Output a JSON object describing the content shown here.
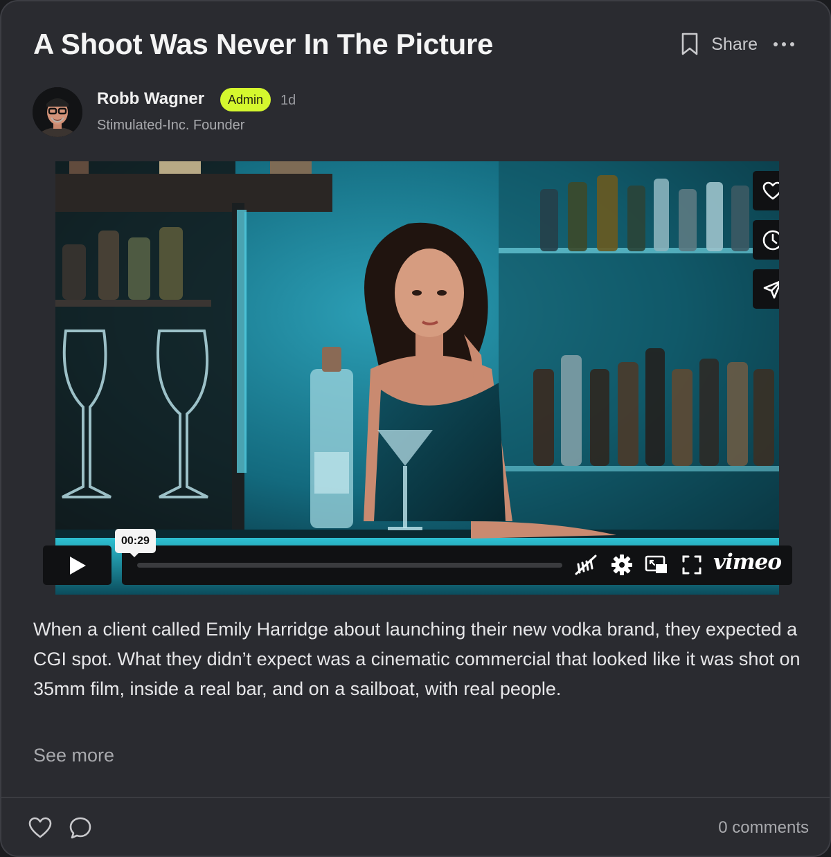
{
  "post": {
    "title": "A Shoot Was Never In The Picture",
    "share_label": "Share"
  },
  "author": {
    "name": "Robb Wagner",
    "badge": "Admin",
    "time": "1d",
    "role": "Stimulated-Inc. Founder"
  },
  "video": {
    "timestamp": "00:29",
    "brand": "vimeo",
    "icons": [
      "heart-icon",
      "clock-icon",
      "send-icon",
      "play-icon",
      "hd-off-icon",
      "settings-icon",
      "pip-icon",
      "fullscreen-icon"
    ]
  },
  "body": {
    "text": "When a client called Emily Harridge about launching their new vodka brand, they expected a CGI spot. What they didn’t expect was a cinematic commercial that looked like it was shot on 35mm film, inside a real bar, and on a sailboat, with real people.",
    "see_more": "See more"
  },
  "footer": {
    "comments": "0 comments"
  },
  "colors": {
    "card": "#2a2b30",
    "badge": "#d5f82e",
    "video_controls": "#101113"
  }
}
